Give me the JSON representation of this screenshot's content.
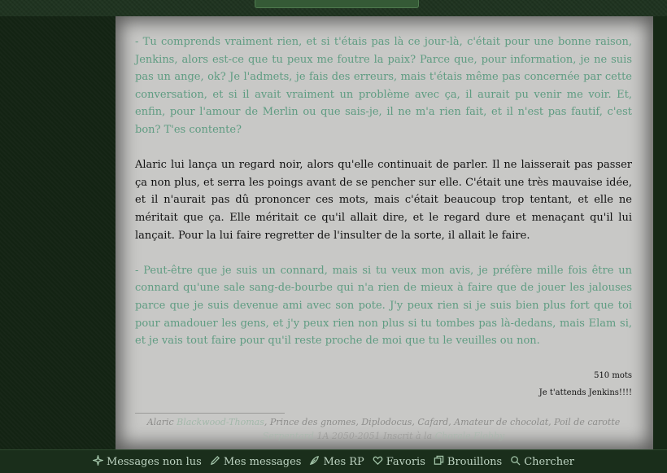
{
  "post": {
    "paragraphs": [
      {
        "type": "dialogue",
        "text": "- Tu comprends vraiment rien, et si t'étais pas là ce jour-là, c'était pour une bonne raison, Jenkins, alors est-ce que tu peux me foutre la paix? Parce que, pour information, je ne suis pas un ange, ok? Je l'admets, je fais des erreurs, mais t'étais même pas concernée par cette conversation, et si il avait vraiment un problème avec ça, il aurait pu venir me voir. Et, enfin, pour l'amour de Merlin ou que sais-je, il ne m'a rien fait, et il n'est pas fautif, c'est bon? T'es contente?"
      },
      {
        "type": "narration",
        "text": "Alaric lui lança un regard noir, alors qu'elle continuait de parler. Il ne laisserait pas passer ça non plus, et serra les poings avant de se pencher sur elle. C'était une très mauvaise idée, et il n'aurait pas dû prononcer ces mots, mais c'était beaucoup trop tentant, et elle ne méritait que ça. Elle méritait ce qu'il allait dire, et le regard dure et menaçant qu'il lui lançait. Pour la lui faire regretter de l'insulter de la sorte, il allait le faire."
      },
      {
        "type": "dialogue",
        "text": "- Peut-être que je suis un connard, mais si tu veux mon avis, je préfère mille fois être un connard qu'une sale sang-de-bourbe qui n'a rien de mieux à faire que de jouer les jalouses parce que je suis devenue ami avec son pote. J'y peux rien si je suis bien plus fort que toi pour amadouer les gens, et j'y peux rien non plus si tu tombes pas là-dedans, mais Elam si, et je vais tout faire pour qu'il reste proche de moi que tu le veuilles ou non."
      }
    ],
    "word_count": "510 mots",
    "closing_note": "Je t'attends Jenkins!!!!"
  },
  "signature": {
    "first_name": "Alaric",
    "last_name_link": "Blackwood-Thomas",
    "titles": ", Prince des gnomes, Diplodocus, Cafard, Amateur de chocolat, Poil de carotte",
    "bottom_link": "Serpentard",
    "bottom_text": " 1A 2050-2051 Inscrit à la ",
    "bottom_link2": "Chorale Flobby"
  },
  "nav": {
    "items": [
      {
        "label": "Messages non lus",
        "icon": "sparkle-icon"
      },
      {
        "label": "Mes messages",
        "icon": "pencil-icon"
      },
      {
        "label": "Mes RP",
        "icon": "feather-icon"
      },
      {
        "label": "Favoris",
        "icon": "heart-icon"
      },
      {
        "label": "Brouillons",
        "icon": "drafts-icon"
      },
      {
        "label": "Chercher",
        "icon": "search-icon"
      }
    ]
  },
  "colors": {
    "dialogue": "#5f9c82",
    "narration": "#111111",
    "panel": "#c8c8c6",
    "background": "#1f3320"
  }
}
